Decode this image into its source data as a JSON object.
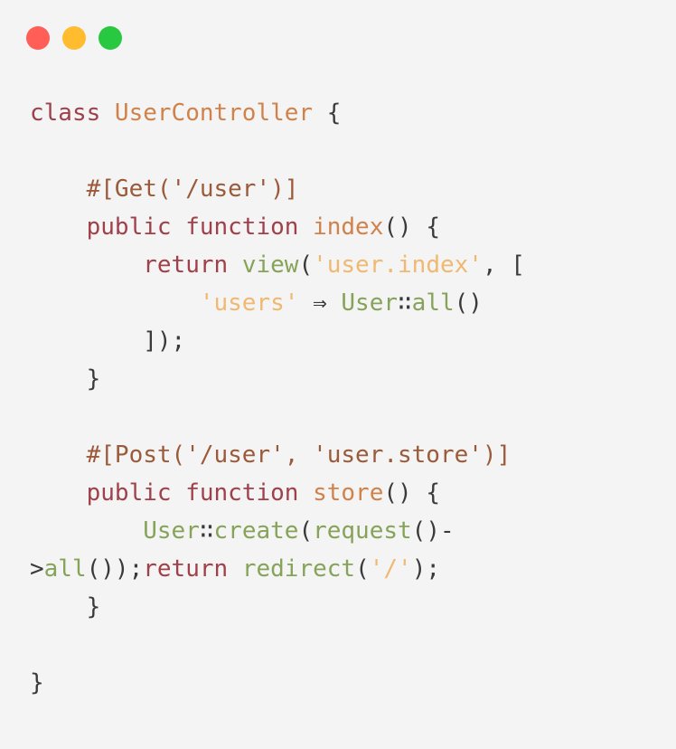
{
  "window": {
    "controls": [
      "close",
      "minimize",
      "maximize"
    ],
    "colors": {
      "close": "#ff5f57",
      "minimize": "#febc2e",
      "maximize": "#28c840",
      "background": "#f4f4f4"
    }
  },
  "code": {
    "language": "php",
    "lines": [
      [
        [
          "kw",
          "class "
        ],
        [
          "cls",
          "UserController"
        ],
        [
          "punc",
          " {"
        ]
      ],
      [],
      [
        [
          "plain",
          "    "
        ],
        [
          "attr",
          "#[Get('/user')]"
        ]
      ],
      [
        [
          "plain",
          "    "
        ],
        [
          "kw",
          "public function "
        ],
        [
          "fn",
          "index"
        ],
        [
          "punc",
          "() {"
        ]
      ],
      [
        [
          "plain",
          "        "
        ],
        [
          "kw",
          "return "
        ],
        [
          "call",
          "view"
        ],
        [
          "punc",
          "("
        ],
        [
          "str",
          "'user.index'"
        ],
        [
          "punc",
          ", ["
        ]
      ],
      [
        [
          "plain",
          "            "
        ],
        [
          "str",
          "'users'"
        ],
        [
          "punc",
          " ⇒ "
        ],
        [
          "call",
          "User"
        ],
        [
          "punc",
          "∷"
        ],
        [
          "call",
          "all"
        ],
        [
          "punc",
          "()"
        ]
      ],
      [
        [
          "plain",
          "        "
        ],
        [
          "punc",
          "]);"
        ]
      ],
      [
        [
          "plain",
          "    "
        ],
        [
          "punc",
          "}"
        ]
      ],
      [],
      [
        [
          "plain",
          "    "
        ],
        [
          "attr",
          "#[Post('/user', 'user.store')]"
        ]
      ],
      [
        [
          "plain",
          "    "
        ],
        [
          "kw",
          "public function "
        ],
        [
          "fn",
          "store"
        ],
        [
          "punc",
          "() {"
        ]
      ],
      [
        [
          "plain",
          "        "
        ],
        [
          "call",
          "User"
        ],
        [
          "punc",
          "∷"
        ],
        [
          "call",
          "create"
        ],
        [
          "punc",
          "("
        ],
        [
          "call",
          "request"
        ],
        [
          "punc",
          "()-"
        ]
      ],
      [
        [
          "punc",
          ">"
        ],
        [
          "call",
          "all"
        ],
        [
          "punc",
          "());"
        ],
        [
          "kw",
          "return "
        ],
        [
          "call",
          "redirect"
        ],
        [
          "punc",
          "("
        ],
        [
          "str",
          "'/'"
        ],
        [
          "punc",
          ");"
        ]
      ],
      [
        [
          "plain",
          "    "
        ],
        [
          "punc",
          "}"
        ]
      ],
      [],
      [
        [
          "punc",
          "}"
        ]
      ]
    ]
  }
}
